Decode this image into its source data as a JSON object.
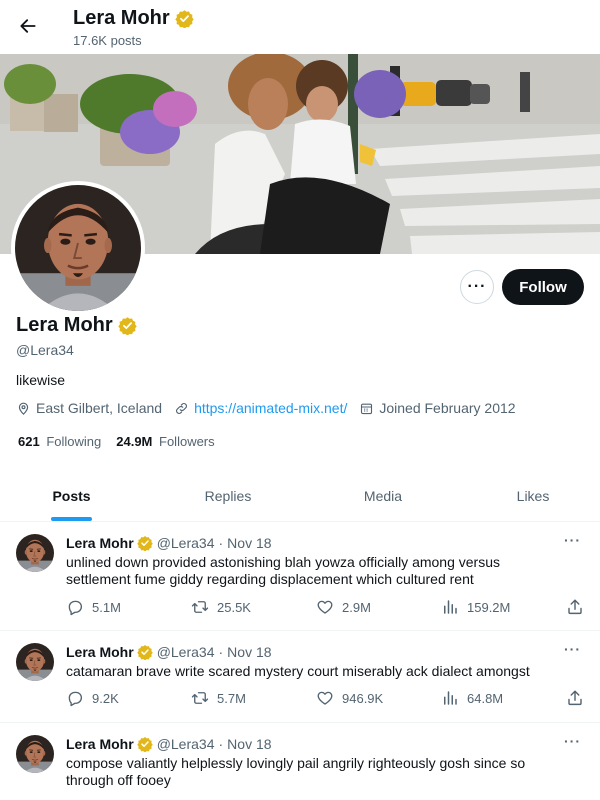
{
  "header": {
    "name": "Lera Mohr",
    "posts_count": "17.6K posts"
  },
  "profile": {
    "name": "Lera Mohr",
    "handle": "@Lera34",
    "bio": "likewise",
    "location": "East Gilbert, Iceland",
    "url": "https://animated-mix.net/",
    "joined": "Joined February 2012",
    "following_count": "621",
    "following_label": "Following",
    "followers_count": "24.9M",
    "followers_label": "Followers",
    "follow_label": "Follow",
    "more_label": "···"
  },
  "colors": {
    "accent": "#1d9bf0",
    "verified": "#e2b719",
    "text": "#0f1419",
    "muted": "#536471"
  },
  "icons": {
    "back": "arrow-left-icon",
    "verified": "verified-badge-icon",
    "location": "location-pin-icon",
    "link": "link-icon",
    "calendar": "calendar-icon",
    "reply": "reply-bubble-icon",
    "repost": "repost-icon",
    "like": "heart-icon",
    "views": "bar-chart-icon",
    "share": "share-upload-icon"
  },
  "tabs": [
    {
      "label": "Posts",
      "active": true
    },
    {
      "label": "Replies",
      "active": false
    },
    {
      "label": "Media",
      "active": false
    },
    {
      "label": "Likes",
      "active": false
    }
  ],
  "posts": [
    {
      "name": "Lera Mohr",
      "handle": "@Lera34",
      "sep": "·",
      "date": "Nov 18",
      "more": "···",
      "text": "unlined down provided astonishing blah yowza officially among versus settlement fume giddy regarding displacement which cultured rent",
      "replies": "5.1M",
      "reposts": "25.5K",
      "likes": "2.9M",
      "views": "159.2M"
    },
    {
      "name": "Lera Mohr",
      "handle": "@Lera34",
      "sep": "·",
      "date": "Nov 18",
      "more": "···",
      "text": "catamaran brave write scared mystery court miserably ack dialect amongst",
      "replies": "9.2K",
      "reposts": "5.7M",
      "likes": "946.9K",
      "views": "64.8M"
    },
    {
      "name": "Lera Mohr",
      "handle": "@Lera34",
      "sep": "·",
      "date": "Nov 18",
      "more": "···",
      "text": "compose valiantly helplessly lovingly pail angrily righteously gosh since so through off fooey"
    }
  ]
}
